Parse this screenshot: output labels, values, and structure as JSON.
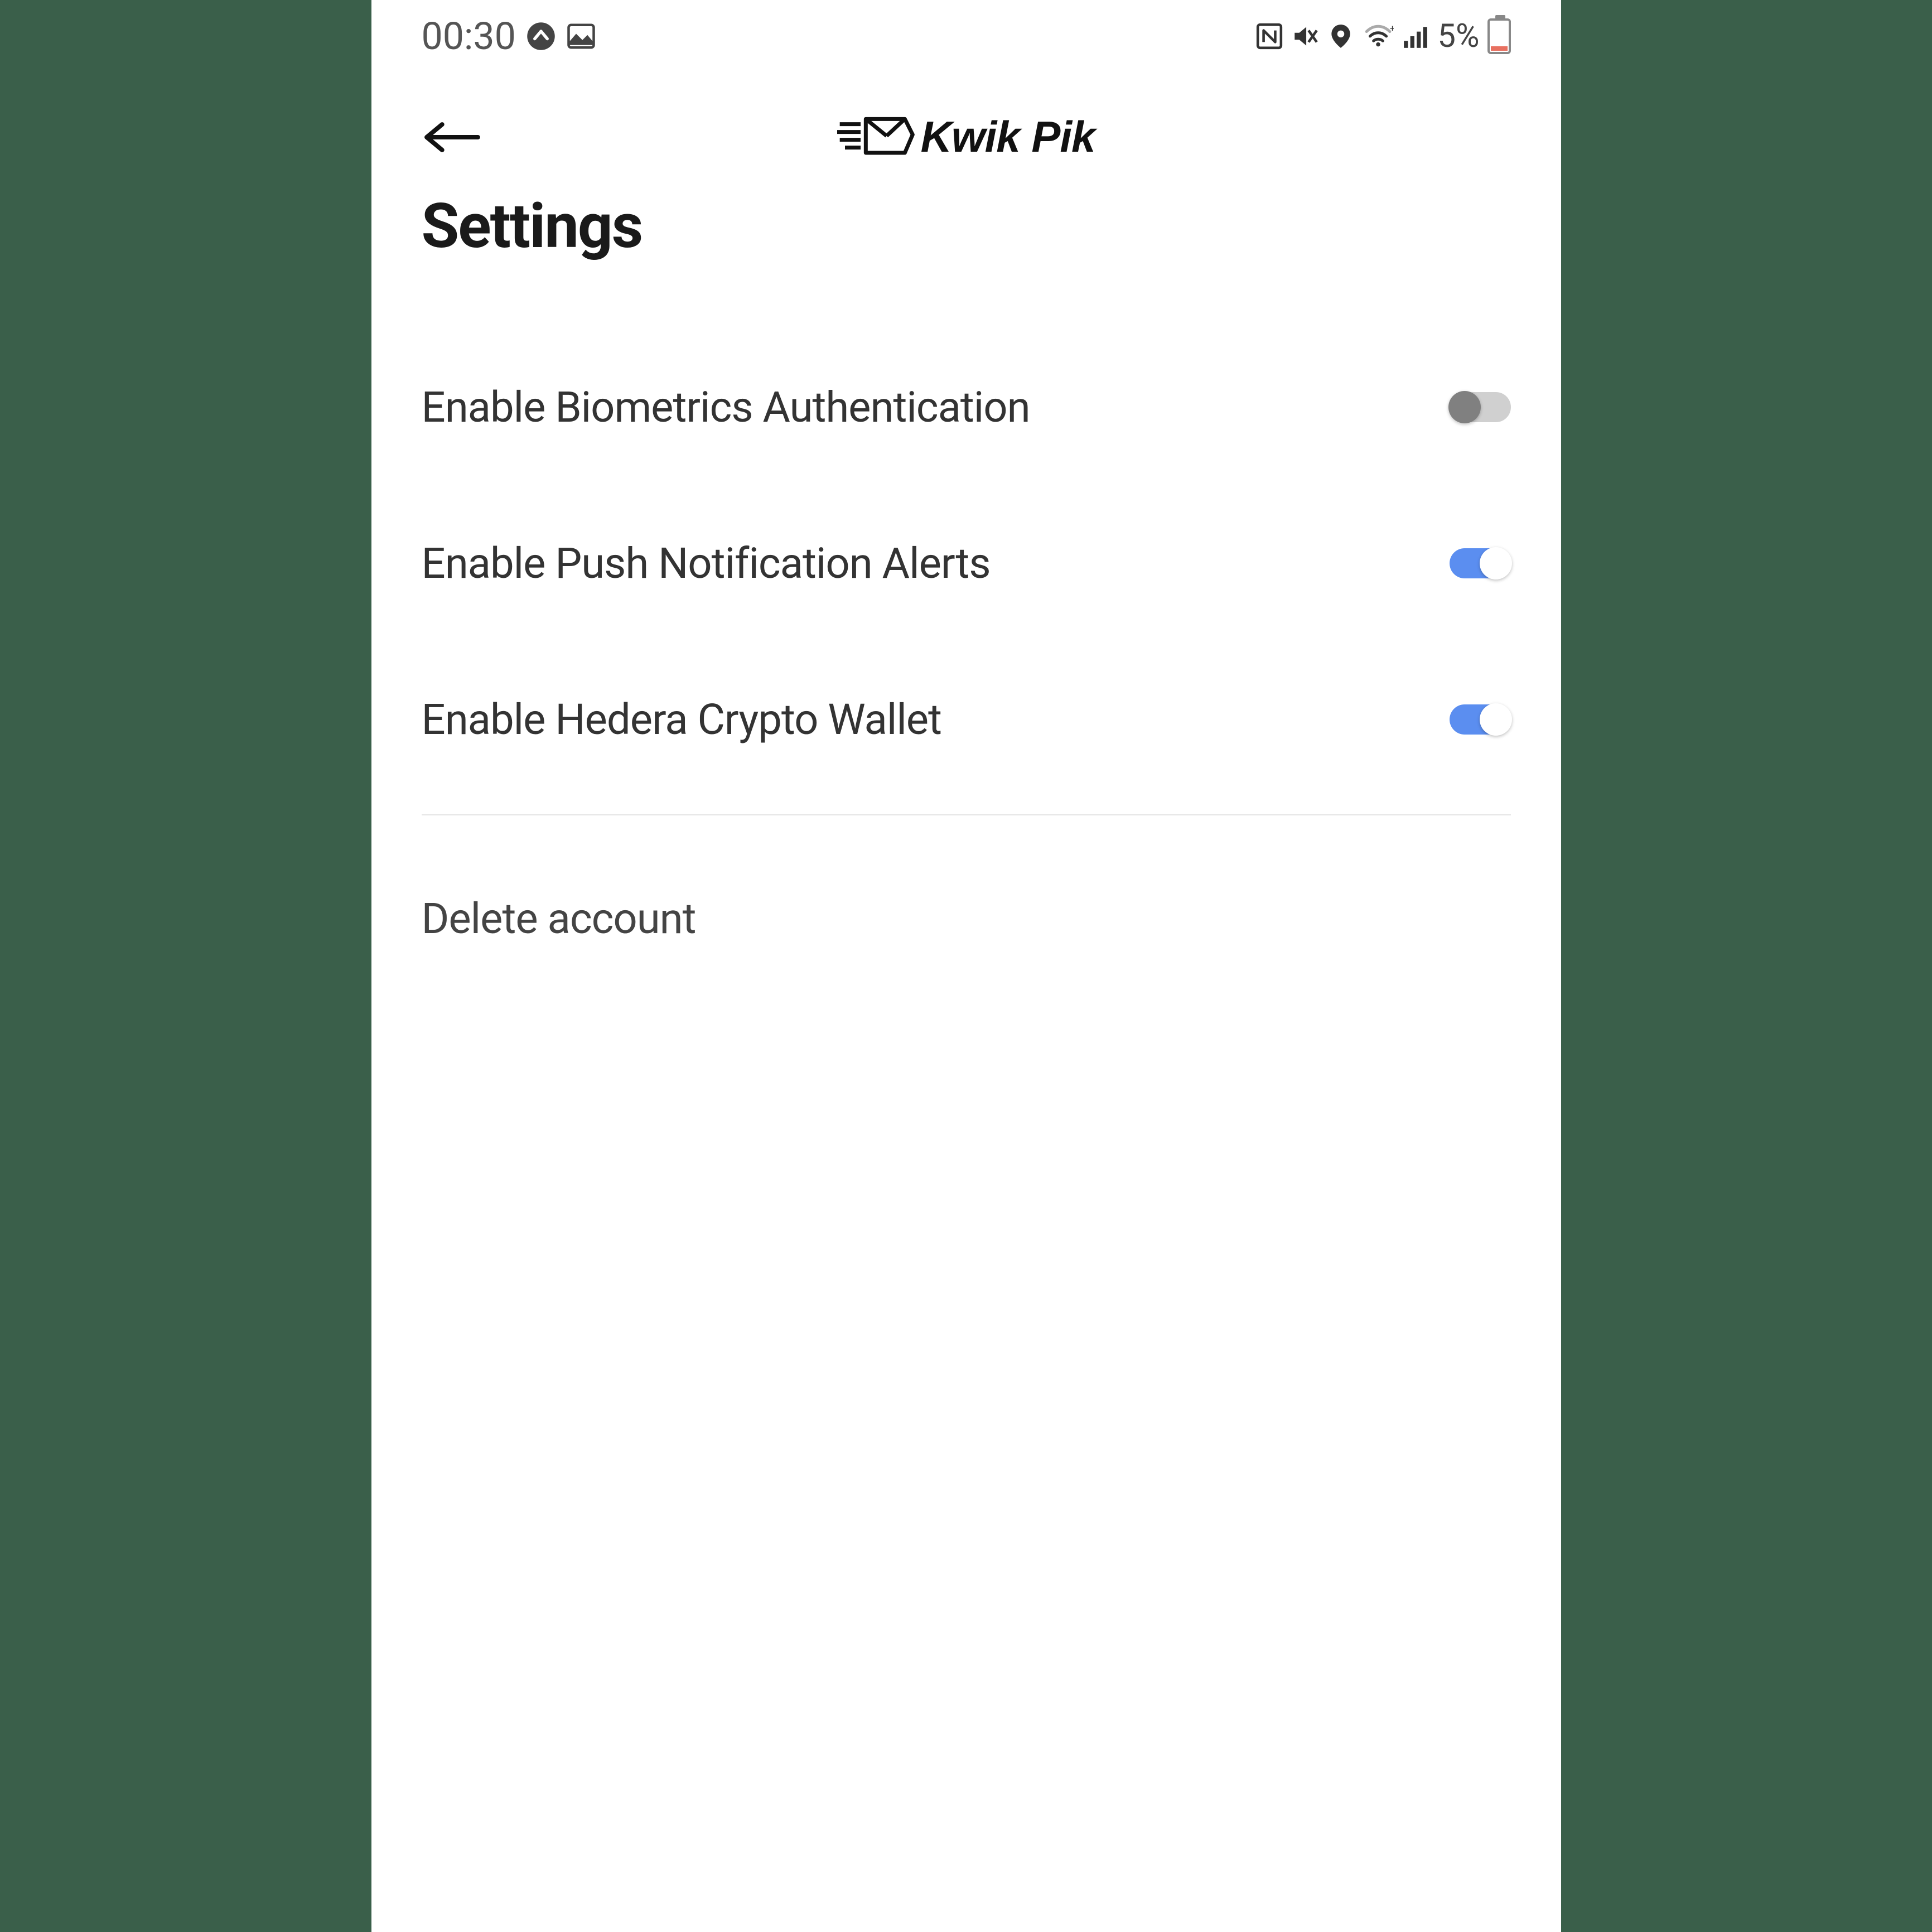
{
  "status": {
    "time": "00:30",
    "battery_pct": "5%"
  },
  "header": {
    "brand": "Kwik Pik"
  },
  "page": {
    "title": "Settings"
  },
  "settings": [
    {
      "label": "Enable Biometrics Authentication",
      "on": false
    },
    {
      "label": "Enable Push Notification Alerts",
      "on": true
    },
    {
      "label": "Enable Hedera Crypto Wallet",
      "on": true
    }
  ],
  "delete_label": "Delete account"
}
